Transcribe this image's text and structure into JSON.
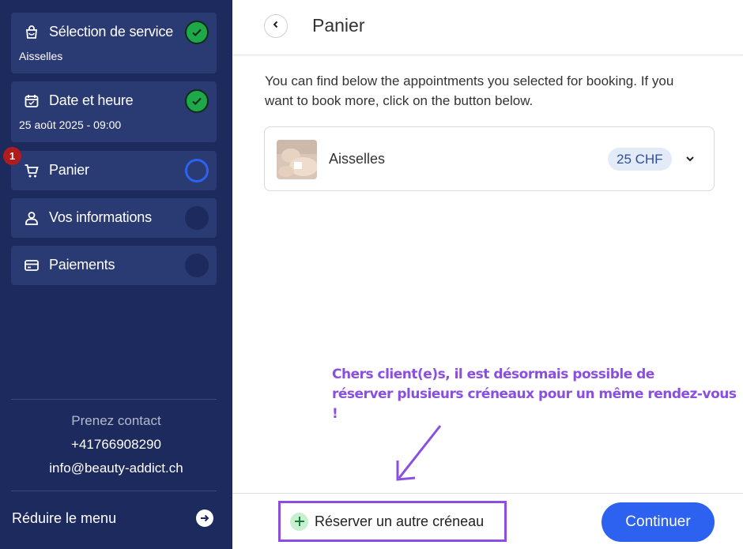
{
  "sidebar": {
    "steps": [
      {
        "label": "Sélection de service",
        "sub": "Aisselles",
        "status": "done",
        "icon": "bag-icon"
      },
      {
        "label": "Date et heure",
        "sub": "25 août 2025 - 09:00",
        "status": "done",
        "icon": "calendar-icon"
      },
      {
        "label": "Panier",
        "sub": "",
        "status": "active",
        "icon": "cart-icon",
        "badge": "1"
      },
      {
        "label": "Vos informations",
        "sub": "",
        "status": "pending",
        "icon": "person-icon"
      },
      {
        "label": "Paiements",
        "sub": "",
        "status": "pending",
        "icon": "credit-card-icon"
      }
    ],
    "contact": {
      "title": "Prenez contact",
      "phone": "+41766908290",
      "email": "info@beauty-addict.ch"
    },
    "reduce_label": "Réduire le menu"
  },
  "header": {
    "title": "Panier"
  },
  "main": {
    "intro_line1": "You can find below the appointments you selected for booking. If you",
    "intro_line2": "want to book more, click on the button below.",
    "cart_item": {
      "name": "Aisselles",
      "price": "25 CHF"
    },
    "notice_line1": "Chers client(e)s, il est désormais possible de",
    "notice_line2": "réserver plusieurs créneaux pour un même rendez-vous !"
  },
  "footer": {
    "add_label": "Réserver un autre créneau",
    "continue_label": "Continuer"
  },
  "colors": {
    "sidebar_bg": "#1c2a5e",
    "step_bg": "#2a3a72",
    "accent": "#2d62f0",
    "success": "#1ea84a",
    "notice": "#8a4fe0",
    "badge": "#b01c1c"
  }
}
